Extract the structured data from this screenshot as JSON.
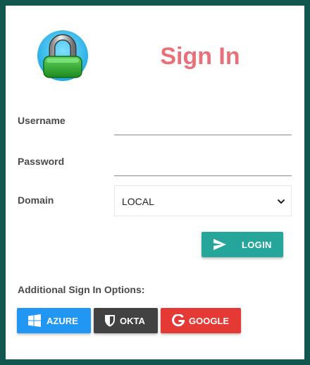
{
  "header": {
    "title": "Sign In",
    "logo_icon": "padlock-icon"
  },
  "form": {
    "username_label": "Username",
    "username_value": "",
    "password_label": "Password",
    "password_value": "",
    "domain_label": "Domain",
    "domain_selected": "LOCAL",
    "domain_options": [
      "LOCAL"
    ],
    "login_label": "LOGIN",
    "login_icon": "send-icon"
  },
  "additional": {
    "label": "Additional Sign In Options:",
    "providers": [
      {
        "label": "AZURE",
        "icon": "windows-icon",
        "color": "#2196f3"
      },
      {
        "label": "OKTA",
        "icon": "shield-icon",
        "color": "#424242"
      },
      {
        "label": "GOOGLE",
        "icon": "google-icon",
        "color": "#e53935"
      }
    ]
  },
  "colors": {
    "background": "#11574f",
    "title": "#e8707a",
    "login_button": "#26a69a"
  }
}
